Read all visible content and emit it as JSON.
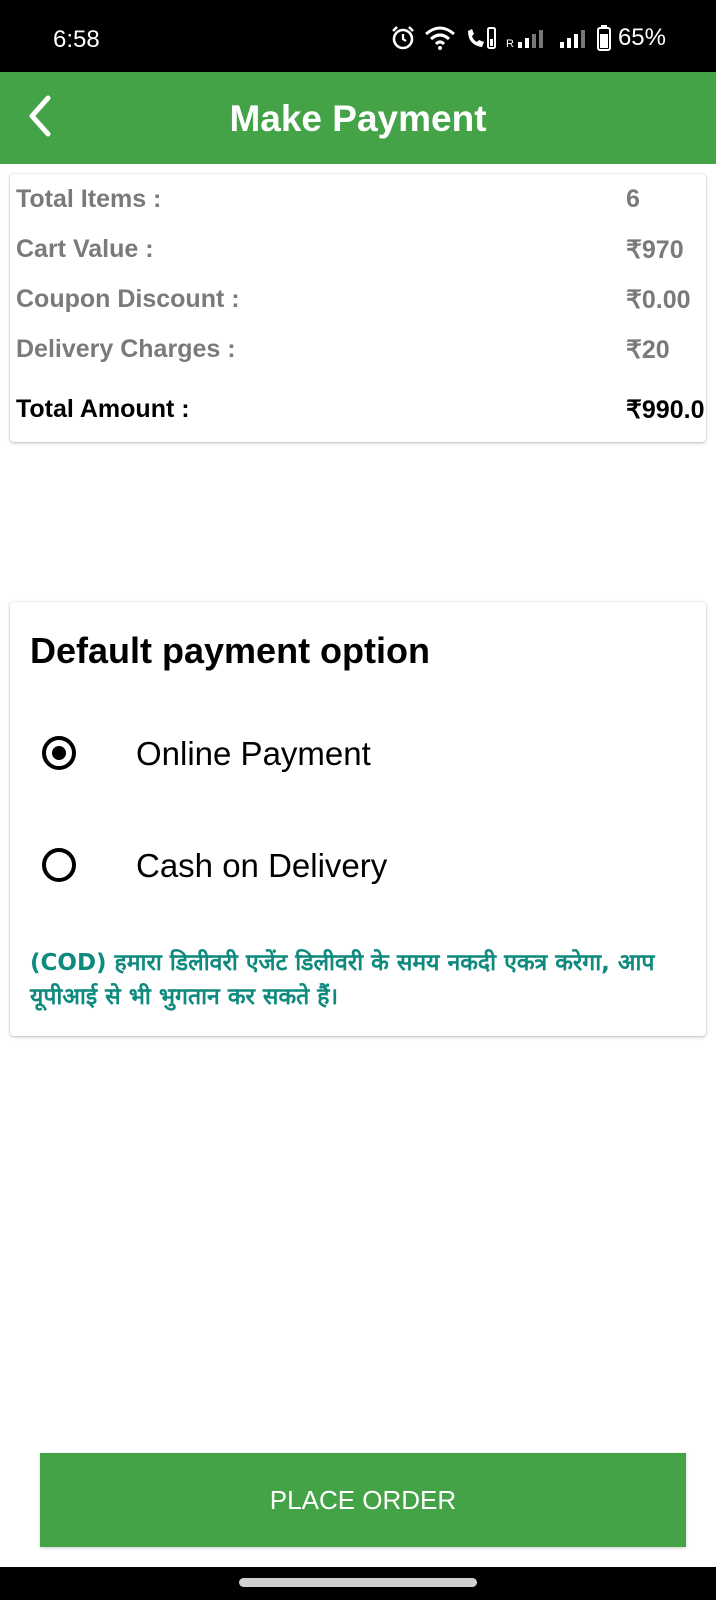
{
  "status_bar": {
    "time": "6:58",
    "network_label": "R",
    "battery_percent": "65%"
  },
  "app_bar": {
    "title": "Make Payment",
    "back_icon": "chevron-left-icon",
    "color": "#44a347"
  },
  "order_summary": {
    "rows": [
      {
        "label": "Total Items :",
        "value": "6"
      },
      {
        "label": "Cart Value :",
        "value": "₹970"
      },
      {
        "label": "Coupon Discount :",
        "value": "₹0.00"
      },
      {
        "label": "Delivery Charges :",
        "value": "₹20"
      }
    ],
    "total": {
      "label": "Total Amount :",
      "value": "₹990.0"
    }
  },
  "payment": {
    "heading": "Default payment option",
    "options": [
      {
        "label": "Online Payment",
        "selected": true
      },
      {
        "label": "Cash on Delivery",
        "selected": false
      }
    ],
    "note": "(COD) हमारा डिलीवरी एजेंट डिलीवरी के समय नकदी एकत्र करेगा, आप यूपीआई से भी भुगतान कर सकते हैं।",
    "note_color": "#0f8a7e"
  },
  "footer": {
    "place_order_label": "PLACE ORDER"
  }
}
